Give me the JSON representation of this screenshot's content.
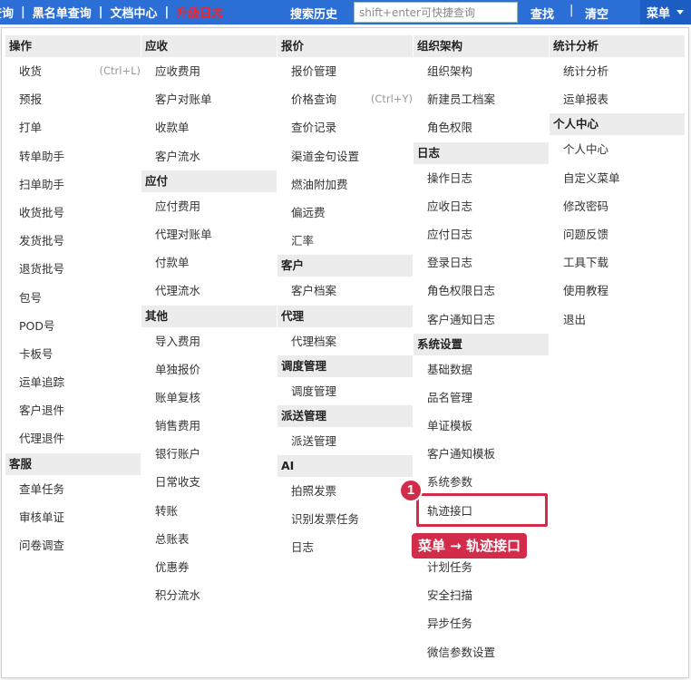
{
  "topnav": {
    "links": [
      {
        "label": "查询",
        "hot": false
      },
      {
        "label": "黑名单查询",
        "hot": false
      },
      {
        "label": "文档中心",
        "hot": false
      },
      {
        "label": "升级日志",
        "hot": true
      }
    ],
    "separator": "|"
  },
  "search": {
    "history_label": "搜索历史",
    "placeholder": "shift+enter可快捷查询",
    "search_button": "查找",
    "clear_button": "清空",
    "divider": "|"
  },
  "menu_button": "菜单",
  "columns": [
    {
      "groups": [
        {
          "header": "操作",
          "items": [
            {
              "label": "收货",
              "shortcut": "(Ctrl+L)"
            },
            {
              "label": "预报"
            },
            {
              "label": "打单"
            },
            {
              "label": "转单助手"
            },
            {
              "label": "扫单助手"
            },
            {
              "label": "收货批号"
            },
            {
              "label": "发货批号"
            },
            {
              "label": "退货批号"
            },
            {
              "label": "包号"
            },
            {
              "label": "POD号"
            },
            {
              "label": "卡板号"
            },
            {
              "label": "运单追踪"
            },
            {
              "label": "客户退件"
            },
            {
              "label": "代理退件"
            }
          ]
        },
        {
          "header": "客服",
          "items": [
            {
              "label": "查单任务"
            },
            {
              "label": "审核单证"
            },
            {
              "label": "问卷调查"
            }
          ]
        }
      ]
    },
    {
      "groups": [
        {
          "header": "应收",
          "items": [
            {
              "label": "应收费用"
            },
            {
              "label": "客户对账单"
            },
            {
              "label": "收款单"
            },
            {
              "label": "客户流水"
            }
          ]
        },
        {
          "header": "应付",
          "items": [
            {
              "label": "应付费用"
            },
            {
              "label": "代理对账单"
            },
            {
              "label": "付款单"
            },
            {
              "label": "代理流水"
            }
          ]
        },
        {
          "header": "其他",
          "items": [
            {
              "label": "导入费用"
            },
            {
              "label": "单独报价"
            },
            {
              "label": "账单复核"
            },
            {
              "label": "销售费用"
            },
            {
              "label": "银行账户"
            },
            {
              "label": "日常收支"
            },
            {
              "label": "转账"
            },
            {
              "label": "总账表"
            },
            {
              "label": "优惠券"
            },
            {
              "label": "积分流水"
            }
          ]
        }
      ]
    },
    {
      "groups": [
        {
          "header": "报价",
          "items": [
            {
              "label": "报价管理"
            },
            {
              "label": "价格查询",
              "shortcut": "(Ctrl+Y)"
            },
            {
              "label": "查价记录"
            },
            {
              "label": "渠道金句设置"
            },
            {
              "label": "燃油附加费"
            },
            {
              "label": "偏远费"
            },
            {
              "label": "汇率"
            }
          ]
        },
        {
          "header": "客户",
          "items": [
            {
              "label": "客户档案"
            }
          ]
        },
        {
          "header": "代理",
          "items": [
            {
              "label": "代理档案"
            }
          ]
        },
        {
          "header": "调度管理",
          "items": [
            {
              "label": "调度管理"
            }
          ]
        },
        {
          "header": "派送管理",
          "items": [
            {
              "label": "派送管理"
            }
          ]
        },
        {
          "header": "AI",
          "items": [
            {
              "label": "拍照发票"
            },
            {
              "label": "识别发票任务"
            },
            {
              "label": "日志"
            }
          ]
        }
      ]
    },
    {
      "groups": [
        {
          "header": "组织架构",
          "items": [
            {
              "label": "组织架构"
            },
            {
              "label": "新建员工档案"
            },
            {
              "label": "角色权限"
            }
          ]
        },
        {
          "header": "日志",
          "items": [
            {
              "label": "操作日志"
            },
            {
              "label": "应收日志"
            },
            {
              "label": "应付日志"
            },
            {
              "label": "登录日志"
            },
            {
              "label": "角色权限日志"
            },
            {
              "label": "客户通知日志"
            }
          ]
        },
        {
          "header": "系统设置",
          "items": [
            {
              "label": "基础数据"
            },
            {
              "label": "品名管理"
            },
            {
              "label": "单证模板"
            },
            {
              "label": "客户通知模板"
            },
            {
              "label": "系统参数"
            },
            {
              "label": "轨迹接口"
            },
            {
              "label": ""
            },
            {
              "label": "计划任务"
            },
            {
              "label": "安全扫描"
            },
            {
              "label": "异步任务"
            },
            {
              "label": "微信参数设置"
            }
          ]
        }
      ]
    },
    {
      "groups": [
        {
          "header": "统计分析",
          "items": [
            {
              "label": "统计分析"
            },
            {
              "label": "运单报表"
            }
          ]
        },
        {
          "header": "个人中心",
          "items": [
            {
              "label": "个人中心"
            },
            {
              "label": "自定义菜单"
            },
            {
              "label": "修改密码"
            },
            {
              "label": "问题反馈"
            },
            {
              "label": "工具下载"
            },
            {
              "label": "使用教程"
            },
            {
              "label": "退出"
            }
          ]
        }
      ]
    }
  ],
  "annotation": {
    "step": "1",
    "callout": "菜单 → 轨迹接口"
  }
}
